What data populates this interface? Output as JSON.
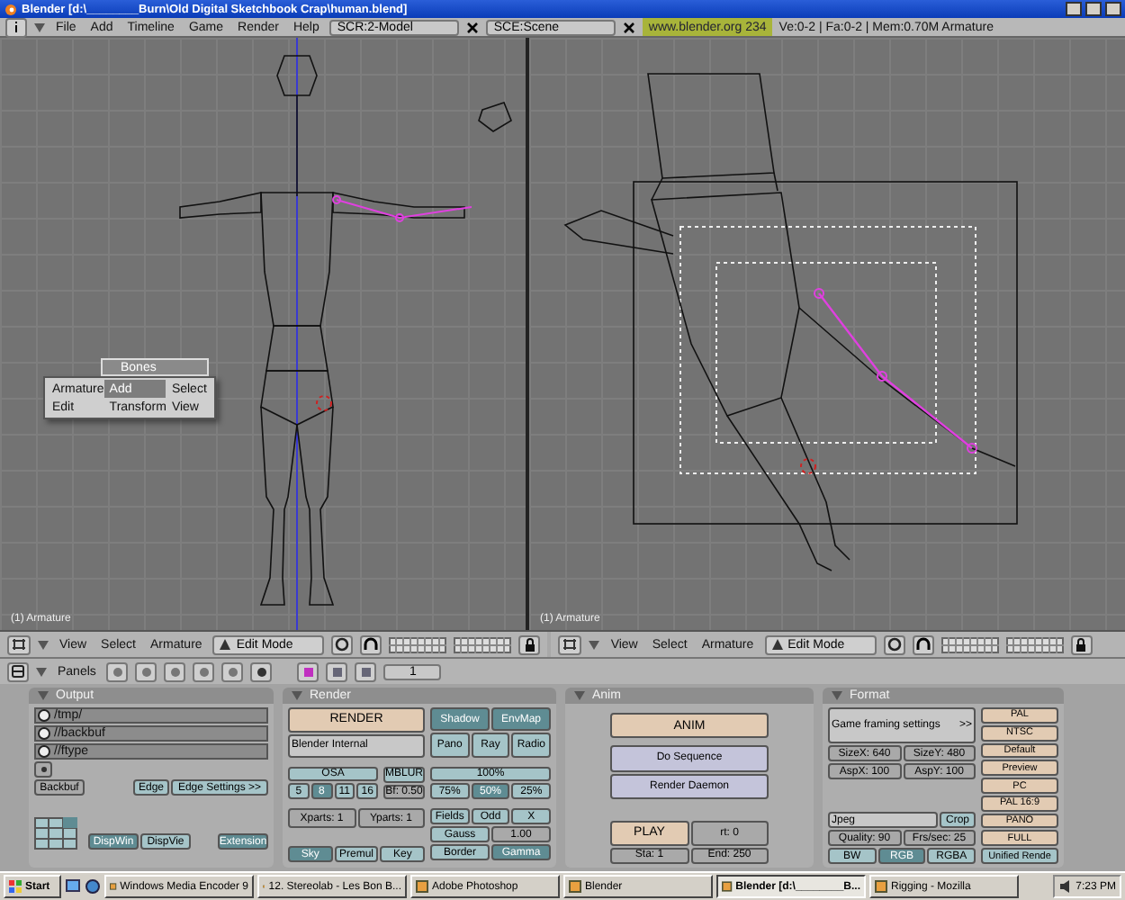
{
  "window": {
    "title": "Blender [d:\\________Burn\\Old Digital Sketchbook Crap\\human.blend]"
  },
  "menu": [
    "File",
    "Add",
    "Timeline",
    "Game",
    "Render",
    "Help"
  ],
  "screen": "SCR:2-Model",
  "scene": "SCE:Scene",
  "info": {
    "link": "www.blender.org 234",
    "stats": "Ve:0-2 | Fa:0-2 | Mem:0.70M Armature"
  },
  "viewports": [
    {
      "kind": "front",
      "label": "(1) Armature",
      "menus": [
        "View",
        "Select",
        "Armature"
      ],
      "mode": "Edit Mode"
    },
    {
      "kind": "camera",
      "label": "(1) Armature",
      "menus": [
        "View",
        "Select",
        "Armature"
      ],
      "mode": "Edit Mode"
    }
  ],
  "popup": {
    "title": "Bones",
    "items": [
      {
        "label": "Armature",
        "selected": false
      },
      {
        "label": "Add",
        "selected": true
      },
      {
        "label": "Select",
        "selected": false
      },
      {
        "label": "Edit",
        "selected": false
      },
      {
        "label": "Transform",
        "selected": false
      },
      {
        "label": "View",
        "selected": false
      }
    ]
  },
  "buttons_header": {
    "title": "Panels",
    "page": "1"
  },
  "output": {
    "title": "Output",
    "paths": [
      "/tmp/",
      "//backbuf",
      "//ftype"
    ],
    "backbuf": {
      "label": "Backbuf",
      "on": false
    },
    "edge": {
      "label": "Edge",
      "on": false
    },
    "edge_settings": "Edge Settings >>",
    "disp": [
      {
        "label": "DispWin",
        "selected": true
      },
      {
        "label": "DispVie",
        "selected": false
      }
    ],
    "extension": "Extension"
  },
  "render": {
    "title": "Render",
    "render_button": "RENDER",
    "toggles": [
      {
        "label": "Shadow",
        "on": true
      },
      {
        "label": "EnvMap",
        "on": true
      },
      {
        "label": "Pano",
        "on": false
      },
      {
        "label": "Ray",
        "on": false
      },
      {
        "label": "Radio",
        "on": false
      }
    ],
    "renderer": "Blender Internal",
    "osa": "OSA",
    "osa_levels": [
      {
        "label": "5",
        "selected": false
      },
      {
        "label": "8",
        "selected": true
      },
      {
        "label": "11",
        "selected": false
      },
      {
        "label": "16",
        "selected": false
      }
    ],
    "mblur": "MBLUR",
    "bf": "Bf: 0.50",
    "size": "100%",
    "sizes": [
      {
        "label": "75%",
        "selected": false
      },
      {
        "label": "50%",
        "selected": true
      },
      {
        "label": "25%",
        "selected": false
      }
    ],
    "parts": [
      "Xparts: 1",
      "Yparts: 1"
    ],
    "fields": [
      {
        "label": "Fields",
        "on": false
      },
      {
        "label": "Odd",
        "on": false
      },
      {
        "label": "X",
        "on": false
      }
    ],
    "filter": "Gauss",
    "filter_value": "1.00",
    "alpha": [
      {
        "label": "Sky",
        "selected": true
      },
      {
        "label": "Premul",
        "selected": false
      },
      {
        "label": "Key",
        "selected": false
      }
    ],
    "extra": [
      {
        "label": "Border",
        "on": false
      },
      {
        "label": "Gamma",
        "on": true
      }
    ]
  },
  "anim": {
    "title": "Anim",
    "anim_button": "ANIM",
    "sequence": "Do Sequence",
    "daemon": "Render Daemon",
    "play": "PLAY",
    "rt": "rt: 0",
    "start": "Sta: 1",
    "end": "End: 250"
  },
  "format": {
    "title": "Format",
    "framing": "Game framing settings",
    "framing_more": ">>",
    "size": [
      "SizeX: 640",
      "SizeY: 480"
    ],
    "aspect": [
      "AspX: 100",
      "AspY: 100"
    ],
    "filetype": "Jpeg",
    "crop": {
      "label": "Crop",
      "on": false
    },
    "quality": "Quality: 90",
    "fps": "Frs/sec: 25",
    "color_modes": [
      {
        "label": "BW",
        "selected": false
      },
      {
        "label": "RGB",
        "selected": true
      },
      {
        "label": "RGBA",
        "selected": false
      }
    ],
    "presets": [
      "PAL",
      "NTSC",
      "Default",
      "Preview",
      "PC",
      "PAL 16:9",
      "PANO",
      "FULL",
      "Unified Rende"
    ]
  },
  "taskbar": {
    "start": "Start",
    "tasks": [
      {
        "label": "Windows Media Encoder 9",
        "selected": false
      },
      {
        "label": "12. Stereolab - Les Bon B...",
        "selected": false
      },
      {
        "label": "Adobe Photoshop",
        "selected": false
      },
      {
        "label": "Blender",
        "selected": false
      },
      {
        "label": "Blender [d:\\________B...",
        "selected": true
      },
      {
        "label": "Rigging - Mozilla",
        "selected": false
      }
    ],
    "time": "7:23 PM"
  }
}
